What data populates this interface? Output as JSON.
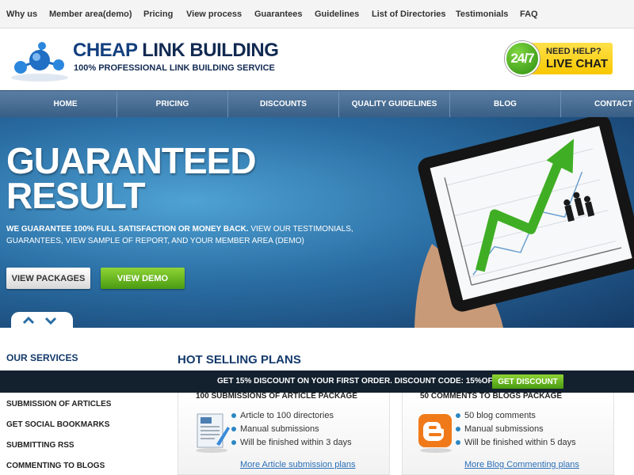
{
  "topnav": {
    "items": [
      "Why us",
      "Member area(demo)",
      "Pricing",
      "View process",
      "Guarantees",
      "Guidelines",
      "List of Directories",
      "Testimonials",
      "FAQ"
    ]
  },
  "header": {
    "logo_title_part1": "CHEAP",
    "logo_title_part2": "LINK BUILDING",
    "logo_subtitle": "100% PROFESSIONAL LINK BUILDING SERVICE",
    "chat_247": "24/7",
    "chat_help": "NEED HELP?",
    "chat_live": "LIVE CHAT"
  },
  "mainnav": {
    "items": [
      "HOME",
      "PRICING",
      "DISCOUNTS",
      "QUALITY GUIDELINES",
      "BLOG",
      "CONTACT U"
    ]
  },
  "hero": {
    "title_line1": "GUARANTEED",
    "title_line2": "RESULT",
    "text_bold": "WE GUARANTEE 100% FULL SATISFACTION OR MONEY BACK.",
    "text_rest": " VIEW OUR TESTIMONIALS, GUARANTEES, VIEW SAMPLE OF REPORT, AND YOUR MEMBER AREA (DEMO)",
    "btn_packages": "VIEW PACKAGES",
    "btn_demo": "VIEW DEMO"
  },
  "services": {
    "title": "OUR SERVICES",
    "items": [
      "SUBMISSION OF ARTICLES",
      "GET SOCIAL BOOKMARKS",
      "SUBMITTING RSS",
      "COMMENTING TO BLOGS"
    ]
  },
  "plans": {
    "title": "HOT SELLING PLANS",
    "cards": [
      {
        "title": "100 SUBMISSIONS OF ARTICLE PACKAGE",
        "icon": "article-document-icon",
        "features": [
          "Article to 100 directories",
          "Manual submissions",
          "Will be finished within 3 days"
        ],
        "link": "More Article submission plans"
      },
      {
        "title": "50 COMMENTS TO BLOGS PACKAGE",
        "icon": "blogger-icon",
        "features": [
          "50 blog comments",
          "Manual submissions",
          "Will be finished within 5 days"
        ],
        "link": "More Blog Commenting plans"
      }
    ]
  },
  "discount": {
    "text": "GET 15% DISCOUNT ON YOUR FIRST ORDER. DISCOUNT CODE: 15%OFF",
    "button": "GET DISCOUNT"
  },
  "colors": {
    "brand_blue": "#133f7e",
    "nav_blue": "#3a5f86",
    "accent_green": "#4a9b12",
    "chat_yellow": "#f7c700",
    "discount_bar": "#13202e"
  }
}
